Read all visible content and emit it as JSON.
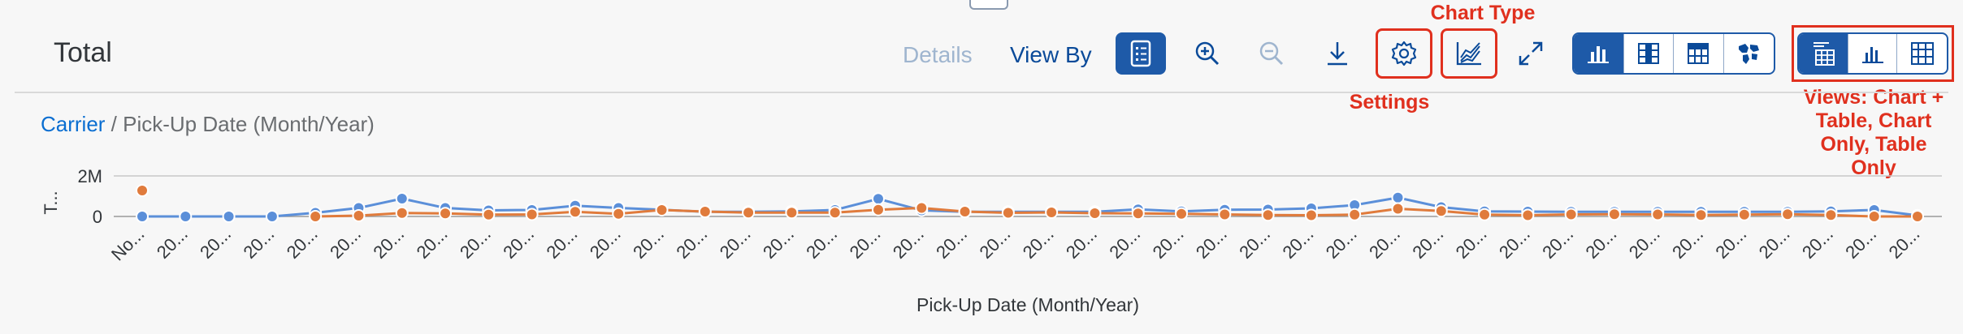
{
  "header": {
    "title": "Total",
    "details_label": "Details",
    "view_by_label": "View By"
  },
  "toolbar": {
    "icons": [
      "legend-icon",
      "zoom-in-icon",
      "zoom-out-icon",
      "download-icon",
      "settings-icon",
      "chart-type-icon",
      "fullscreen-icon"
    ],
    "chart_style_buttons": [
      "column-chart-icon",
      "stacked-table-icon",
      "grid-table-icon",
      "choropleth-icon"
    ],
    "view_buttons": [
      "chart-and-table-icon",
      "chart-only-icon",
      "table-only-icon"
    ]
  },
  "annotations": {
    "chart_type": "Chart Type",
    "settings": "Settings",
    "views": "Views: Chart + Table, Chart Only, Table Only"
  },
  "colors": {
    "accent": "#1e5aa8",
    "annotation": "#e0301e",
    "series_blue": "#5b8fd9",
    "series_orange": "#e07b3c"
  },
  "breadcrumb": {
    "link": "Carrier",
    "separator": " / ",
    "current": "Pick-Up Date (Month/Year)"
  },
  "chart_data": {
    "type": "line",
    "xlabel": "Pick-Up Date (Month/Year)",
    "ylabel": "T...",
    "y_ticks": [
      "2M",
      "0"
    ],
    "ylim": [
      0,
      2000000
    ],
    "grid": true,
    "categories": [
      "No...",
      "20...",
      "20...",
      "20...",
      "20...",
      "20...",
      "20...",
      "20...",
      "20...",
      "20...",
      "20...",
      "20...",
      "20...",
      "20...",
      "20...",
      "20...",
      "20...",
      "20...",
      "20...",
      "20...",
      "20...",
      "20...",
      "20...",
      "20...",
      "20...",
      "20...",
      "20...",
      "20...",
      "20...",
      "20...",
      "20...",
      "20...",
      "20...",
      "20...",
      "20...",
      "20...",
      "20...",
      "20...",
      "20...",
      "20...",
      "20...",
      "20..."
    ],
    "series": [
      {
        "color": "#5b8fd9",
        "values": [
          0,
          0,
          0,
          0,
          180000,
          420000,
          880000,
          420000,
          300000,
          320000,
          530000,
          420000,
          330000,
          230000,
          230000,
          250000,
          320000,
          870000,
          300000,
          230000,
          230000,
          230000,
          230000,
          350000,
          250000,
          330000,
          340000,
          400000,
          560000,
          930000,
          460000,
          250000,
          240000,
          230000,
          230000,
          230000,
          230000,
          230000,
          230000,
          250000,
          320000,
          50000
        ]
      },
      {
        "color": "#e07b3c",
        "values": [
          1280000,
          null,
          null,
          null,
          0,
          40000,
          170000,
          150000,
          90000,
          100000,
          230000,
          130000,
          320000,
          240000,
          190000,
          190000,
          190000,
          330000,
          420000,
          240000,
          180000,
          200000,
          160000,
          150000,
          130000,
          100000,
          70000,
          60000,
          90000,
          380000,
          270000,
          90000,
          60000,
          100000,
          110000,
          100000,
          70000,
          90000,
          110000,
          70000,
          0,
          0
        ]
      }
    ]
  }
}
